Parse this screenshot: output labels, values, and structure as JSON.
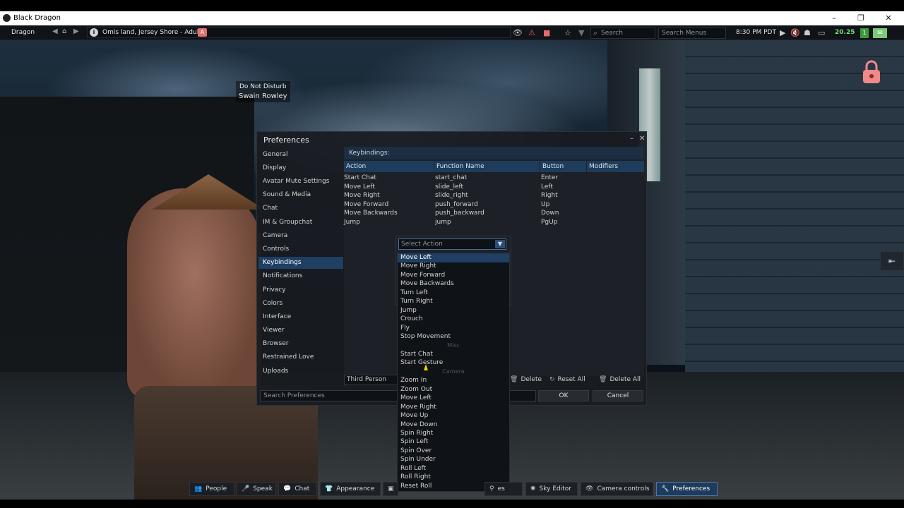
{
  "window": {
    "title": "Black Dragon",
    "minimize": "–",
    "restore": "❐",
    "close": "✕"
  },
  "topbar": {
    "menu_label": "Dragon",
    "location": "Omis land, Jersey Shore - Adult",
    "rating_badge": "A",
    "search_placeholder": "Search",
    "search_menus_placeholder": "Search Menus",
    "clock": "8:30 PM PDT",
    "fps": "20.25",
    "notifications": "1"
  },
  "avatar": {
    "status": "Do Not Disturb",
    "name": "Swain Rowley"
  },
  "preferences": {
    "title": "Preferences",
    "categories": [
      {
        "label": "General"
      },
      {
        "label": "Display"
      },
      {
        "label": "Avatar Mute Settings"
      },
      {
        "label": "Sound & Media"
      },
      {
        "label": "Chat"
      },
      {
        "label": "IM & Groupchat"
      },
      {
        "label": "Camera"
      },
      {
        "label": "Controls"
      },
      {
        "label": "Keybindings"
      },
      {
        "label": "Notifications"
      },
      {
        "label": "Privacy"
      },
      {
        "label": "Colors"
      },
      {
        "label": "Interface"
      },
      {
        "label": "Viewer"
      },
      {
        "label": "Browser"
      },
      {
        "label": "Restrained Love"
      },
      {
        "label": "Uploads"
      }
    ],
    "selected_category": "Keybindings",
    "panel_header": "Keybindings:",
    "columns": {
      "action": "Action",
      "function": "Function Name",
      "button": "Button",
      "modifiers": "Modifiers"
    },
    "rows": [
      {
        "action": "Start Chat",
        "function": "start_chat",
        "button": "Enter",
        "modifiers": ""
      },
      {
        "action": "Move Left",
        "function": "slide_left",
        "button": "Left",
        "modifiers": ""
      },
      {
        "action": "Move Right",
        "function": "slide_right",
        "button": "Right",
        "modifiers": ""
      },
      {
        "action": "Move Forward",
        "function": "push_forward",
        "button": "Up",
        "modifiers": ""
      },
      {
        "action": "Move Backwards",
        "function": "push_backward",
        "button": "Down",
        "modifiers": ""
      },
      {
        "action": "Jump",
        "function": "jump",
        "button": "PgUp",
        "modifiers": ""
      }
    ],
    "mode": "Third Person",
    "delete_label": "Delete",
    "reset_all_label": "Reset All",
    "delete_all_label": "Delete All",
    "search_placeholder": "Search Preferences",
    "ok_label": "OK",
    "cancel_label": "Cancel"
  },
  "action_dropdown": {
    "placeholder": "Select Action",
    "items": [
      {
        "label": "Move Left"
      },
      {
        "label": "Move Right"
      },
      {
        "label": "Move Forward"
      },
      {
        "label": "Move Backwards"
      },
      {
        "label": "Turn Left"
      },
      {
        "label": "Turn Right"
      },
      {
        "label": "Jump"
      },
      {
        "label": "Crouch"
      },
      {
        "label": "Fly"
      },
      {
        "label": "Stop Movement"
      },
      {
        "label": "Misc"
      },
      {
        "label": "Start Chat"
      },
      {
        "label": "Start Gesture"
      },
      {
        "label": "Camera"
      },
      {
        "label": "Zoom In"
      },
      {
        "label": "Zoom Out"
      },
      {
        "label": "Move Left"
      },
      {
        "label": "Move Right"
      },
      {
        "label": "Move Up"
      },
      {
        "label": "Move Down"
      },
      {
        "label": "Spin Right"
      },
      {
        "label": "Spin Left"
      },
      {
        "label": "Spin Over"
      },
      {
        "label": "Spin Under"
      },
      {
        "label": "Roll Left"
      },
      {
        "label": "Roll Right"
      },
      {
        "label": "Reset Roll"
      }
    ]
  },
  "bottombar": {
    "people": "People",
    "speak": "Speak",
    "chat": "Chat",
    "appearance": "Appearance",
    "partial": "es",
    "sky_editor": "Sky Editor",
    "camera_controls": "Camera controls",
    "preferences": "Preferences"
  }
}
